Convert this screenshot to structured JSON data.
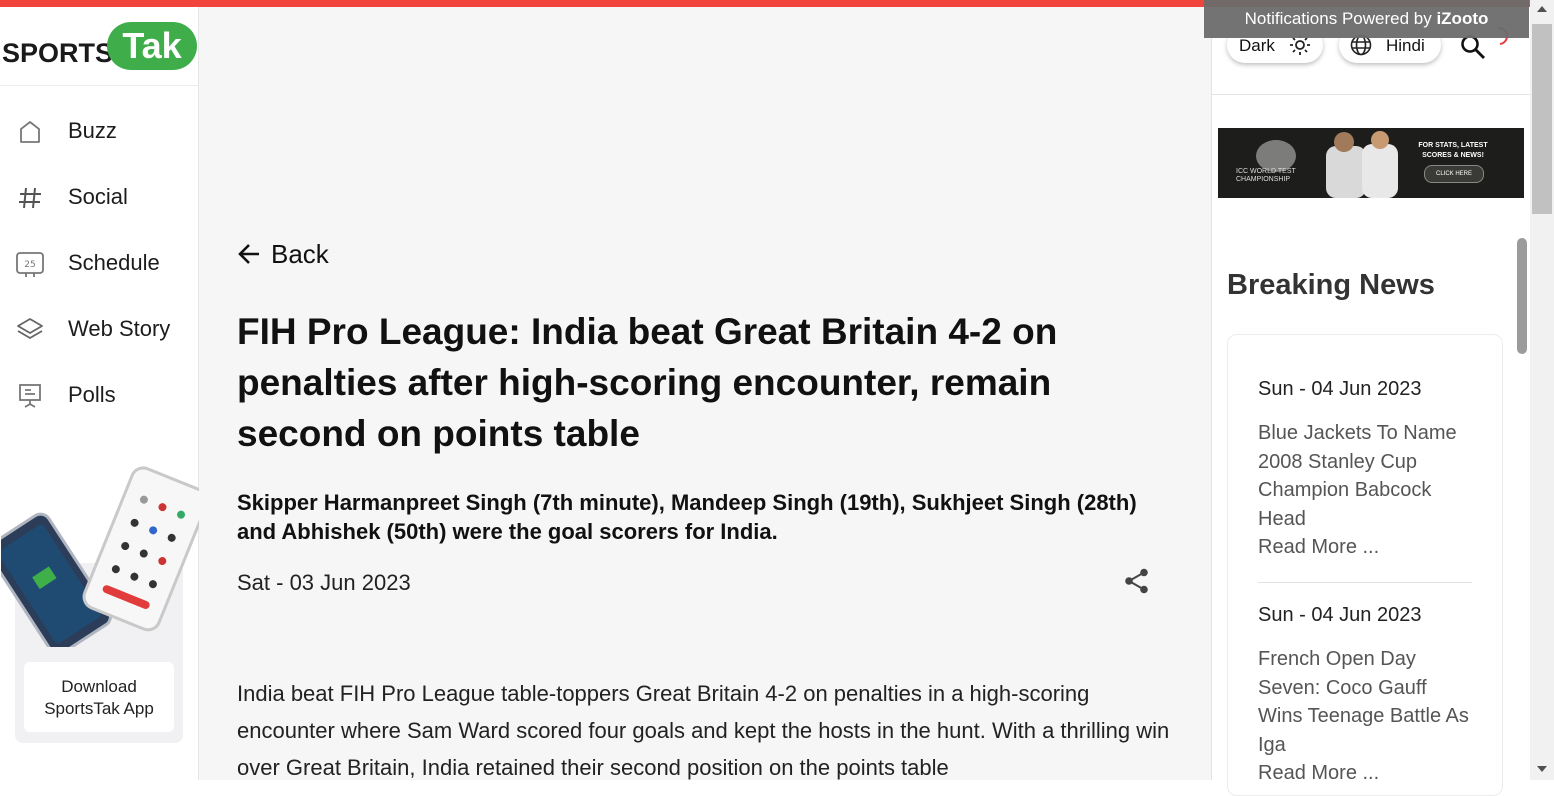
{
  "brand": {
    "logo_part1": "SPORTS",
    "logo_part2": "Tak",
    "accent": "#3fae4a",
    "topbar_color": "#f0443c"
  },
  "sidebar": {
    "items": [
      {
        "label": "Buzz",
        "icon": "home-icon"
      },
      {
        "label": "Social",
        "icon": "hashtag-icon"
      },
      {
        "label": "Schedule",
        "icon": "calendar-icon"
      },
      {
        "label": "Web Story",
        "icon": "layers-icon"
      },
      {
        "label": "Polls",
        "icon": "poll-board-icon"
      }
    ],
    "download_line1": "Download",
    "download_line2": "SportsTak App"
  },
  "header": {
    "dark_label": "Dark",
    "hindi_label": "Hindi",
    "notification": "Notifications Powered by",
    "notification_brand": "iZooto"
  },
  "banner": {
    "wtc_text": "ICC WORLD TEST CHAMPIONSHIP",
    "stats_text": "FOR STATS, LATEST SCORES & NEWS!",
    "click_text": "CLICK HERE"
  },
  "article": {
    "back_label": "Back",
    "headline": "FIH Pro League: India beat Great Britain 4-2 on penalties after high-scoring encounter, remain second on points table",
    "summary": "Skipper Harmanpreet Singh (7th minute), Mandeep Singh (19th), Sukhjeet Singh (28th) and Abhishek (50th) were the goal scorers for India.",
    "date": "Sat - 03 Jun 2023",
    "body": "India beat FIH Pro League table-toppers Great Britain 4-2 on penalties in a high-scoring encounter where Sam Ward scored four goals and kept the hosts in the hunt. With a thrilling win over Great Britain, India retained their second position on the points table"
  },
  "breaking_news": {
    "title": "Breaking News",
    "items": [
      {
        "date": "Sun - 04 Jun 2023",
        "title": "Blue Jackets To Name 2008 Stanley Cup Champion Babcock Head",
        "more": "Read More ..."
      },
      {
        "date": "Sun - 04 Jun 2023",
        "title": "French Open Day Seven: Coco Gauff Wins Teenage Battle As Iga",
        "more": "Read More ..."
      }
    ]
  }
}
